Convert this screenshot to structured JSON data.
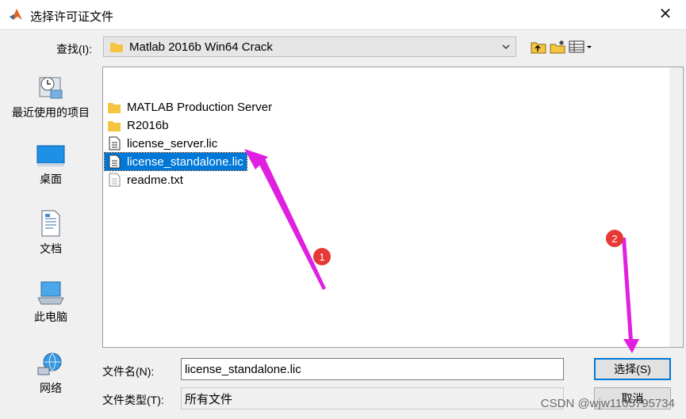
{
  "window": {
    "title": "选择许可证文件",
    "close_glyph": "✕"
  },
  "lookin": {
    "label": "查找(I):",
    "value": "Matlab 2016b Win64 Crack"
  },
  "places": [
    {
      "label": "最近使用的项目",
      "icon": "recent-places-icon"
    },
    {
      "label": "桌面",
      "icon": "desktop-icon"
    },
    {
      "label": "文档",
      "icon": "documents-icon"
    },
    {
      "label": "此电脑",
      "icon": "this-pc-icon"
    },
    {
      "label": "网络",
      "icon": "network-icon"
    }
  ],
  "files": [
    {
      "name": "MATLAB Production Server",
      "type": "folder"
    },
    {
      "name": "R2016b",
      "type": "folder"
    },
    {
      "name": "license_server.lic",
      "type": "file"
    },
    {
      "name": "license_standalone.lic",
      "type": "file",
      "selected": true
    },
    {
      "name": "readme.txt",
      "type": "text"
    }
  ],
  "filename": {
    "label": "文件名(N):",
    "value": "license_standalone.lic"
  },
  "filetype": {
    "label": "文件类型(T):",
    "value": "所有文件"
  },
  "buttons": {
    "select": "选择(S)",
    "cancel": "取消"
  },
  "annotations": {
    "marker1": "1",
    "marker2": "2",
    "color": "#e020e0",
    "badge_color": "#e53935"
  },
  "watermark": "CSDN @wjw1105795734"
}
